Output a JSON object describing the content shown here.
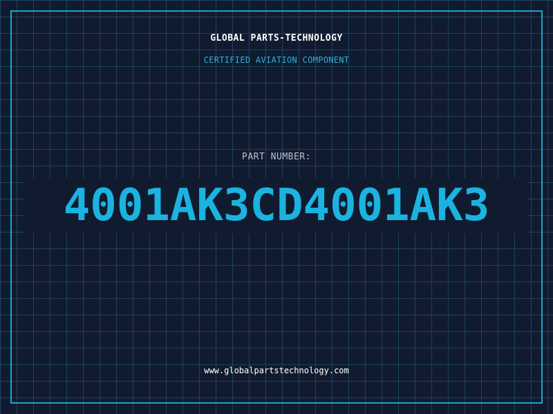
{
  "header": {
    "company": "GLOBAL PARTS-TECHNOLOGY",
    "subtitle": "CERTIFIED AVIATION COMPONENT"
  },
  "part": {
    "label": "PART NUMBER:",
    "number": "4001AK3CD4001AK3"
  },
  "footer": {
    "url": "www.globalpartstechnology.com"
  },
  "colors": {
    "background": "#111b30",
    "grid": "#23627c",
    "frame": "#1aa7cc",
    "accent": "#1bb3e0",
    "text": "#ffffff"
  }
}
